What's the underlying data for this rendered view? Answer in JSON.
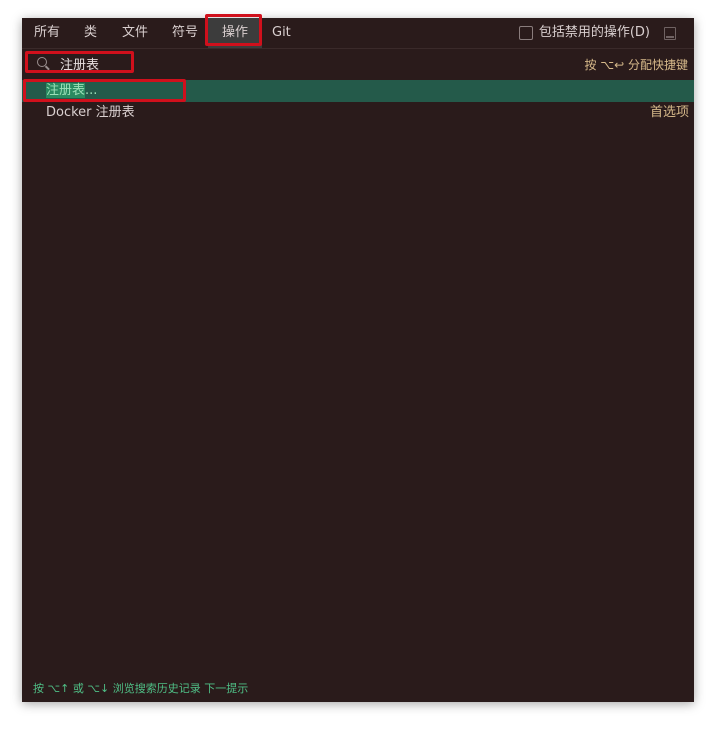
{
  "tabs": [
    {
      "label": "所有"
    },
    {
      "label": "类"
    },
    {
      "label": "文件"
    },
    {
      "label": "符号"
    },
    {
      "label": "操作"
    },
    {
      "label": "Git"
    }
  ],
  "include_disabled": {
    "label": "包括禁用的操作(D)",
    "checked": false
  },
  "search": {
    "value": "注册表",
    "shortcut_hint": "按 ⌥↩ 分配快捷键"
  },
  "results": [
    {
      "label_match": "注册表",
      "label_rest": "...",
      "type": ""
    },
    {
      "label_match": "",
      "label_rest": "Docker 注册表",
      "type": "首选项"
    }
  ],
  "footer": {
    "hint": "按 ⌥↑ 或 ⌥↓ 浏览搜索历史记录  下一提示"
  },
  "colors": {
    "background": "#2a1b1b",
    "selection": "#245a4a",
    "highlight_box": "#d0101c",
    "hint_text": "#d6b98a",
    "footer_text": "#4fbf86"
  },
  "icons": [
    "search-icon",
    "checkbox-icon",
    "pin-icon"
  ]
}
